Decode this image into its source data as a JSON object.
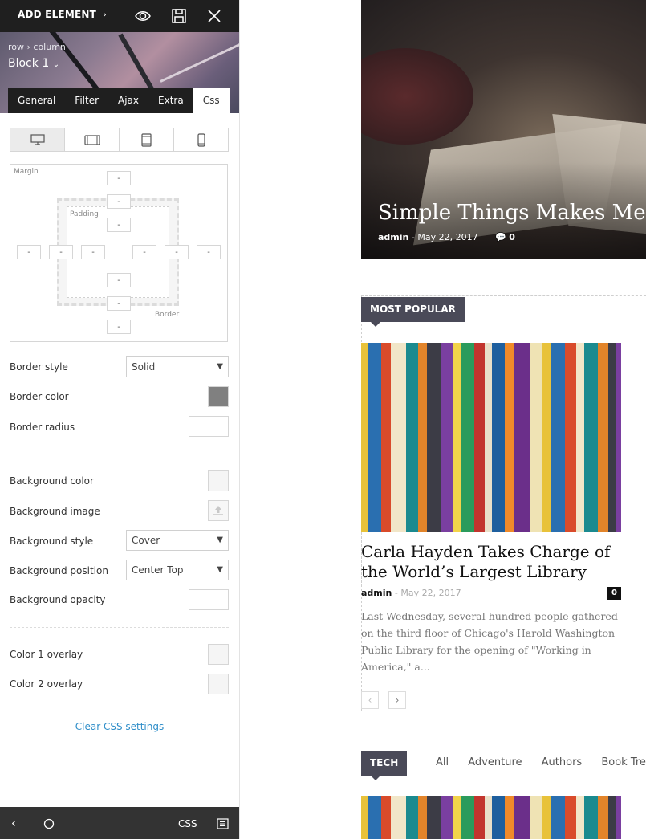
{
  "toolbar": {
    "add_element": "ADD ELEMENT",
    "icons": [
      "eye-icon",
      "save-icon",
      "close-icon"
    ]
  },
  "header": {
    "breadcrumb": "row › column",
    "block_title": "Block 1"
  },
  "tabs": [
    {
      "label": "General"
    },
    {
      "label": "Filter"
    },
    {
      "label": "Ajax"
    },
    {
      "label": "Extra"
    },
    {
      "label": "Css",
      "active": true
    }
  ],
  "devices": [
    "desktop-icon",
    "tablet-landscape-icon",
    "tablet-portrait-icon",
    "phone-icon"
  ],
  "box_model": {
    "margin_label": "Margin",
    "padding_label": "Padding",
    "border_label": "Border",
    "empty_value": "-"
  },
  "css_settings": {
    "border_style": {
      "label": "Border style",
      "value": "Solid"
    },
    "border_color": {
      "label": "Border color",
      "color": "#808080"
    },
    "border_radius": {
      "label": "Border radius"
    },
    "background_color": {
      "label": "Background color",
      "color": "#f5f5f5"
    },
    "background_image": {
      "label": "Background image"
    },
    "background_style": {
      "label": "Background style",
      "value": "Cover"
    },
    "background_position": {
      "label": "Background position",
      "value": "Center Top"
    },
    "background_opacity": {
      "label": "Background opacity"
    },
    "color1_overlay": {
      "label": "Color 1 overlay"
    },
    "color2_overlay": {
      "label": "Color 2 overlay"
    },
    "clear": "Clear CSS settings"
  },
  "bottombar": {
    "css_label": "CSS"
  },
  "hero": {
    "title": "Simple Things Makes Me H",
    "author": "admin",
    "date": "May 22, 2017",
    "comments": "0"
  },
  "popular": {
    "label": "MOST POPULAR",
    "article_title": "Carla Hayden Takes Charge of the World’s Largest Library",
    "author": "admin",
    "date": "May 22, 2017",
    "comments": "0",
    "excerpt": "Last Wednesday, several hundred people gathered on the third floor of Chicago's Harold Washington Public Library for the opening of \"Working in America,\" a..."
  },
  "tech": {
    "label": "TECH",
    "filters": [
      "All",
      "Adventure",
      "Authors",
      "Book Trends"
    ]
  }
}
